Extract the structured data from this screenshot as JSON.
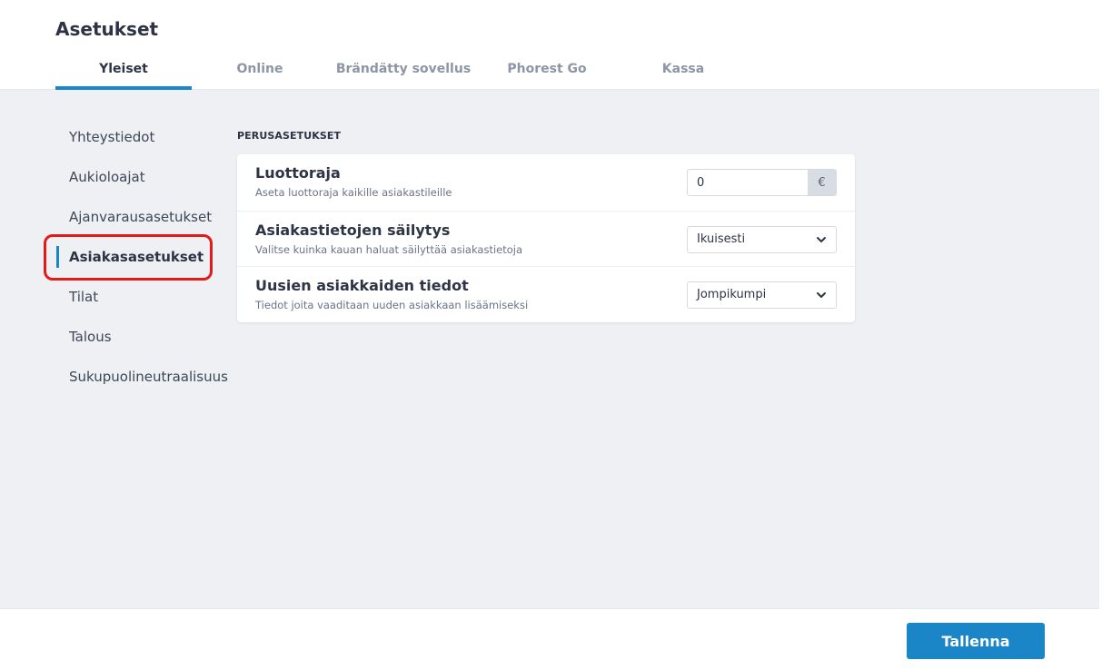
{
  "header": {
    "title": "Asetukset",
    "tabs": [
      {
        "label": "Yleiset",
        "active": true
      },
      {
        "label": "Online",
        "active": false
      },
      {
        "label": "Brändätty sovellus",
        "active": false
      },
      {
        "label": "Phorest Go",
        "active": false
      },
      {
        "label": "Kassa",
        "active": false
      }
    ]
  },
  "sidebar": {
    "items": [
      {
        "label": "Yhteystiedot",
        "active": false
      },
      {
        "label": "Aukioloajat",
        "active": false
      },
      {
        "label": "Ajanvarausasetukset",
        "active": false
      },
      {
        "label": "Asiakasasetukset",
        "active": true
      },
      {
        "label": "Tilat",
        "active": false
      },
      {
        "label": "Talous",
        "active": false
      },
      {
        "label": "Sukupuolineutraalisuus",
        "active": false
      }
    ]
  },
  "main": {
    "section_title": "PERUSASETUKSET",
    "rows": [
      {
        "title": "Luottoraja",
        "description": "Aseta luottoraja kaikille asiakastileille",
        "control": "input",
        "value": "0",
        "addon": "€"
      },
      {
        "title": "Asiakastietojen säilytys",
        "description": "Valitse kuinka kauan haluat säilyttää asiakastietoja",
        "control": "select",
        "value": "Ikuisesti"
      },
      {
        "title": "Uusien asiakkaiden tiedot",
        "description": "Tiedot joita vaaditaan uuden asiakkaan lisäämiseksi",
        "control": "select",
        "value": "Jompikumpi"
      }
    ]
  },
  "footer": {
    "save_label": "Tallenna"
  },
  "colors": {
    "accent": "#1b86c7",
    "highlight": "#e11b1b",
    "background": "#eef0f3"
  }
}
